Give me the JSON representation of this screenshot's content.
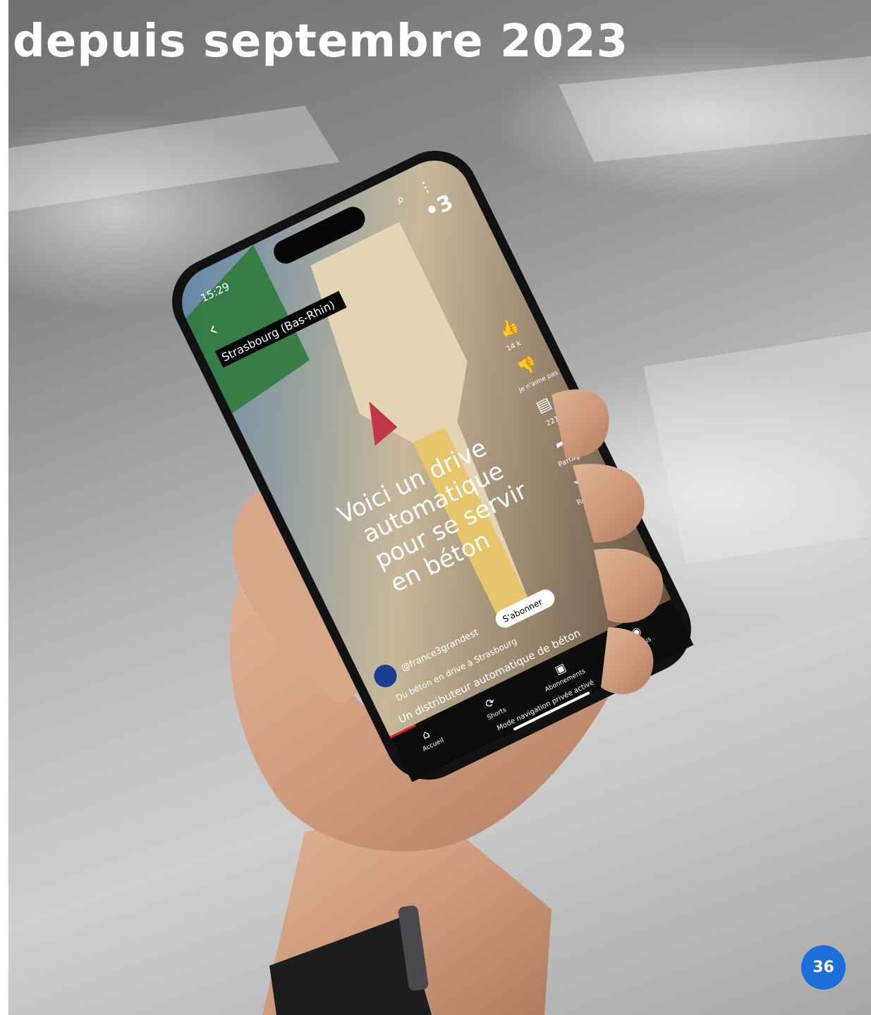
{
  "heading": "depuis septembre 2023",
  "page_number": "36",
  "phone": {
    "status_time": "15:29",
    "location_tag": "Strasbourg (Bas-Rhin)",
    "channel_logo": "•3",
    "overlay_lines": [
      "Voici un drive",
      "automatique",
      "pour se servir",
      "en béton"
    ],
    "channel_handle": "@france3grandest",
    "subscribe_label": "S'abonner",
    "video_title": "Du béton en drive à Strasbourg",
    "description": "Un distributeur automatique de béton",
    "side_actions": [
      "14 k",
      "Je n'aime pas",
      "221",
      "Partager",
      "Remixer"
    ],
    "nav": [
      "Accueil",
      "Shorts",
      "Abonnements",
      "Vous"
    ],
    "private_mode": "Mode navigation privée activé",
    "icons": [
      "search-icon",
      "more-icon",
      "back-icon",
      "like-icon",
      "dislike-icon",
      "comment-icon",
      "share-icon",
      "remix-icon",
      "home-icon",
      "shorts-icon",
      "subscriptions-icon",
      "profile-icon"
    ]
  },
  "colors": {
    "badge": "#1a6fd8",
    "heading": "#ffffff"
  }
}
